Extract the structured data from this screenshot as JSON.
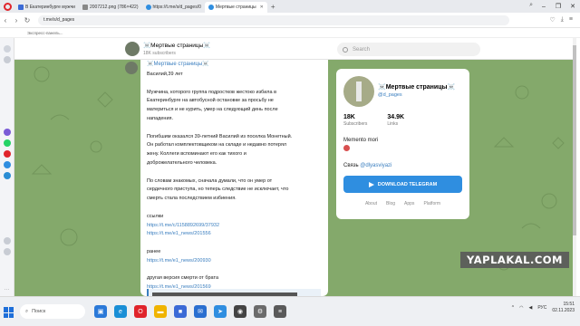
{
  "browser": {
    "tabs": [
      {
        "label": "В Екатеринбурге мужчи",
        "color": "#3b6ad6",
        "active": false
      },
      {
        "label": "2007212.png (786×422)",
        "color": "#888888",
        "active": false
      },
      {
        "label": "https://t.me/s/d_pages/0",
        "color": "#2f8ee0",
        "active": false
      },
      {
        "label": "Мертвые страницы",
        "color": "#2f8ee0",
        "active": true
      }
    ],
    "new_tab": "+",
    "url": "t.me/s/d_pages",
    "bookmarks_hint": "Экспресс-панель..."
  },
  "telegram": {
    "channel_title": "☠️Мертвые страницы☠️",
    "channel_subscribers": "18K subscribers",
    "search_placeholder": "Search",
    "post": {
      "author": "☠️Мертвые страницы☠️",
      "lines": [
        "Василий,39 лет",
        "",
        "Мужчина, которого группа подростков жестоко избила в",
        "Екатеринбурге на автобусной остановке за просьбу не",
        "материться и не курить, умер на следующий день после",
        "нападения.",
        "",
        "Погибшим оказался 39-летний Василий из поселка Монетный.",
        "Он работал комплектовщиком на складе и недавно потерял",
        "жену. Коллеги вспоминают его как тихого и",
        "доброжелательного человека.",
        "",
        "По словам знакомых, сначала думали, что он умер от",
        "сердечного приступа, но теперь следствие не исключает, что",
        "смерть стала последствием избиения."
      ],
      "sources_label": "ссылки",
      "link1": "https://t.me/c/1158892699/37932",
      "link2": "https://t.me/e1_news/201556",
      "earlier_label": "ранее",
      "link3": "https://t.me/e1_news/200930",
      "other_label": "другая версия смерти от брата",
      "link4": "https://t.me/e1_news/201569"
    },
    "card": {
      "title": "☠️Мертвые страницы☠️",
      "handle": "@d_pages",
      "subscribers_value": "18K",
      "subscribers_label": "Subscribers",
      "links_value": "34.9K",
      "links_label": "Links",
      "description": "Memento mori",
      "contact_label": "Связь",
      "contact_handle": "@dlyasviyazi",
      "download_button": "DOWNLOAD TELEGRAM",
      "footer": [
        "About",
        "Blog",
        "Apps",
        "Platform"
      ]
    }
  },
  "watermark": "YAPLAKAL.COM",
  "taskbar": {
    "search_placeholder": "Поиск",
    "tray_lang_top": "РУС",
    "tray_lang_bottom": "",
    "weather": "",
    "time": "15:51",
    "date": "02.11.2023",
    "apps": [
      {
        "name": "widgets",
        "color": "#2b79d8",
        "glyph": "▣"
      },
      {
        "name": "edge",
        "color": "#1a8fd6",
        "glyph": "e"
      },
      {
        "name": "opera",
        "color": "#e0242b",
        "glyph": "O"
      },
      {
        "name": "explorer",
        "color": "#f0b400",
        "glyph": "▬"
      },
      {
        "name": "store",
        "color": "#3b6ad6",
        "glyph": "■"
      },
      {
        "name": "mail",
        "color": "#2a6fd0",
        "glyph": "✉"
      },
      {
        "name": "telegram",
        "color": "#2f8ee0",
        "glyph": "➤"
      },
      {
        "name": "camera",
        "color": "#444444",
        "glyph": "◉"
      },
      {
        "name": "settings",
        "color": "#6b6b6b",
        "glyph": "⚙"
      },
      {
        "name": "calculator",
        "color": "#5a5a5a",
        "glyph": "≡"
      }
    ]
  }
}
